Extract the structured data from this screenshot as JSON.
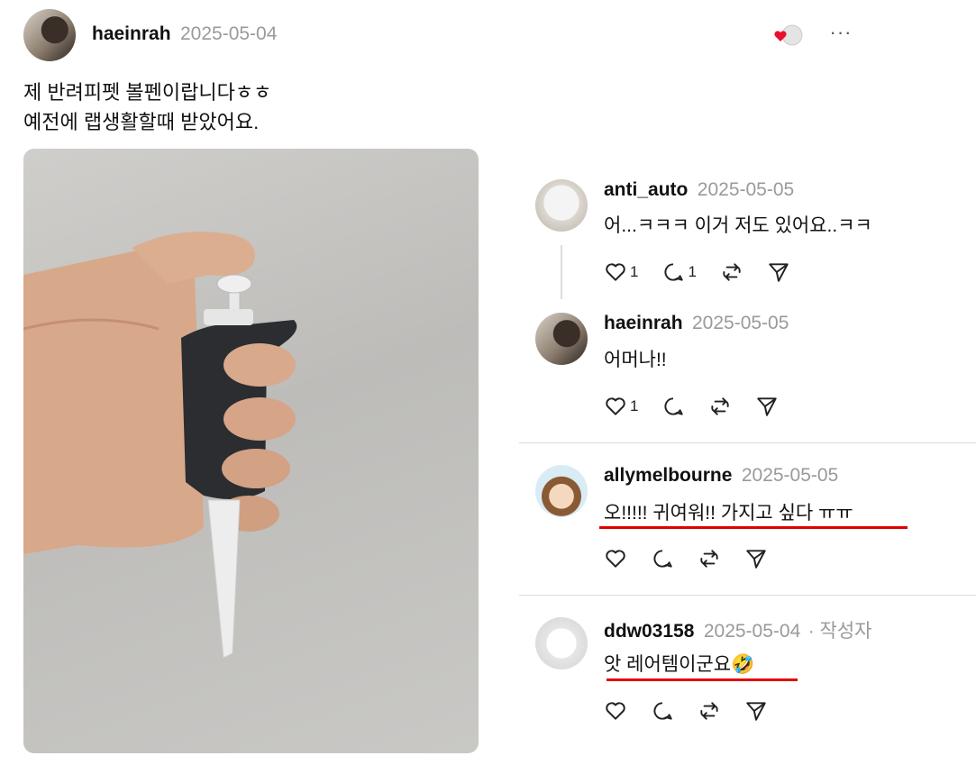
{
  "post": {
    "username": "haeinrah",
    "date": "2025-05-04",
    "text_line1": "제 반려피펫 볼펜이랍니다ㅎㅎ",
    "text_line2": "예전에 랩생활할때 받았어요."
  },
  "comments": [
    {
      "username": "anti_auto",
      "date": "2025-05-05",
      "text": "어...ㅋㅋㅋ 이거 저도 있어요..ㅋㅋ",
      "likes": "1",
      "replies": "1"
    },
    {
      "username": "haeinrah",
      "date": "2025-05-05",
      "text": "어머나!!",
      "likes": "1",
      "replies": ""
    },
    {
      "username": "allymelbourne",
      "date": "2025-05-05",
      "text": "오!!!!! 귀여워!! 가지고 싶다 ㅠㅠ",
      "likes": "",
      "replies": ""
    },
    {
      "username": "ddw03158",
      "date": "2025-05-04",
      "author_tag": "· 작성자",
      "text": "앗 레어템이군요",
      "emoji": "🤣",
      "likes": "",
      "replies": ""
    }
  ],
  "icons": {
    "like": "heart-icon",
    "reply": "comment-icon",
    "repost": "repost-icon",
    "share": "send-icon",
    "more": "more-icon"
  },
  "more_glyph": "···",
  "colors": {
    "accent_underline": "#e00000",
    "muted": "#9a9a9a"
  }
}
